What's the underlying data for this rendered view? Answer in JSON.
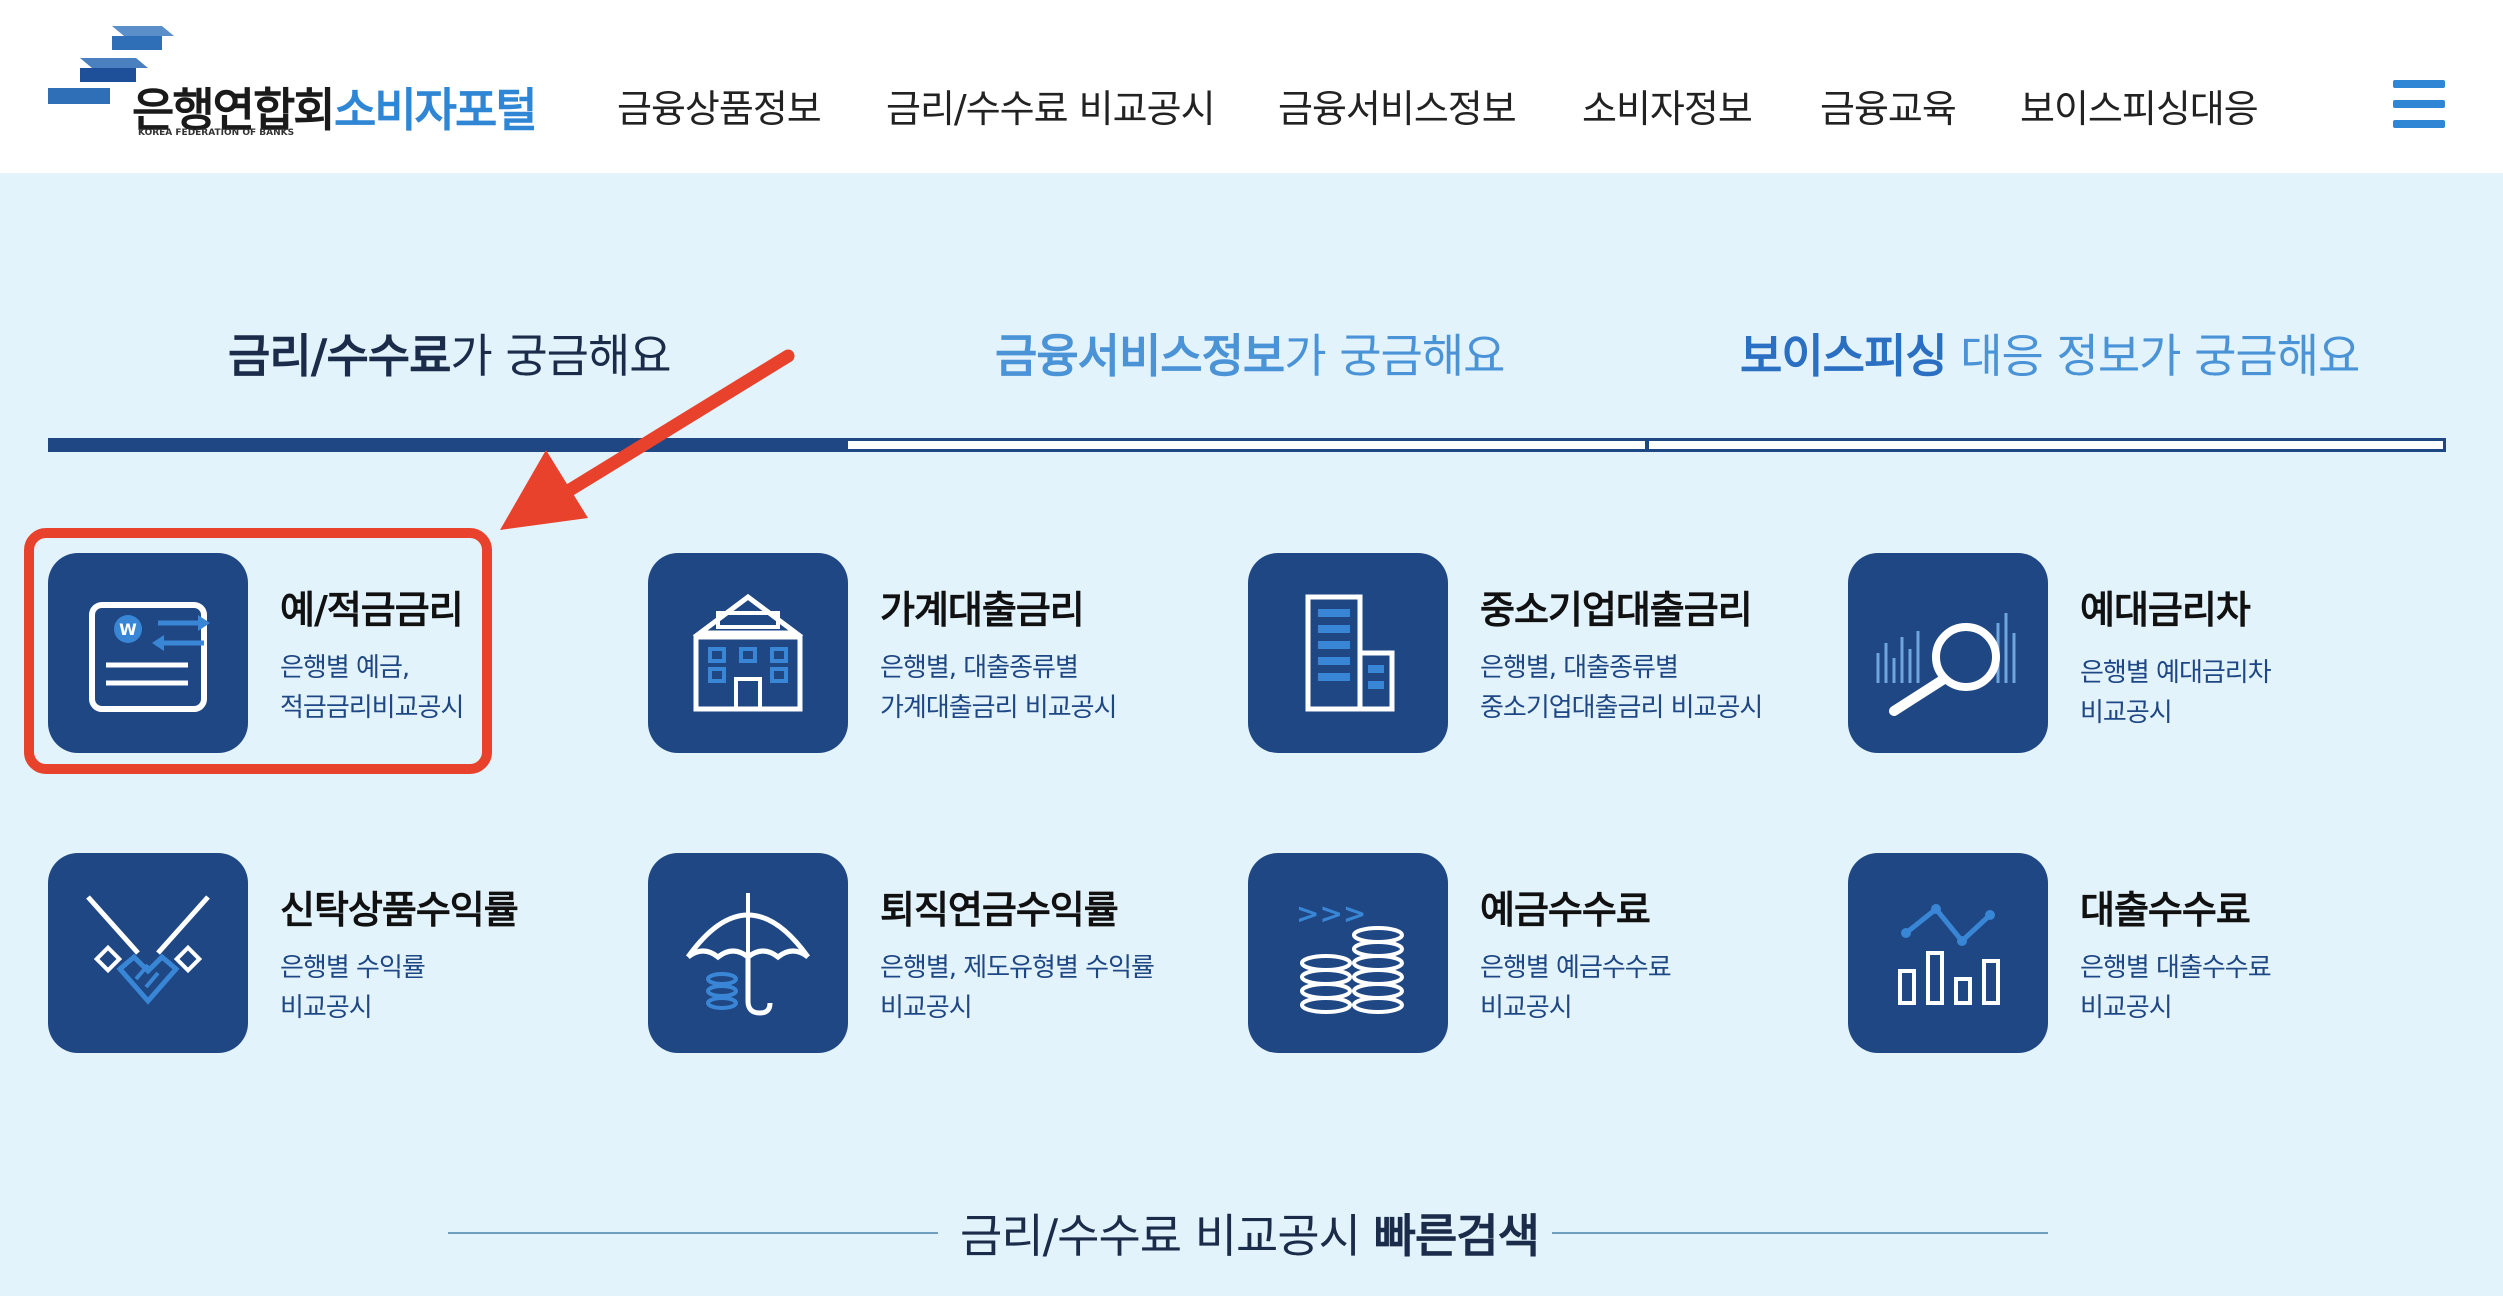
{
  "header": {
    "logo_kr": "은행연합회",
    "logo_en": "KOREA FEDERATION OF BANKS",
    "portal": "소비자포털",
    "nav": [
      "금융상품정보",
      "금리/수수료 비교공시",
      "금융서비스정보",
      "소비자정보",
      "금융교육",
      "보이스피싱대응"
    ],
    "menu_icon": "hamburger-menu-icon"
  },
  "tabs": [
    {
      "strong": "금리/수수료",
      "rest": "가 궁금해요",
      "active": true
    },
    {
      "strong": "금융서비스정보",
      "rest": "가 궁금해요",
      "active": false
    },
    {
      "strong": "보이스피싱",
      "rest": " 대응 정보가 궁금해요",
      "active": false
    }
  ],
  "cards": [
    {
      "title": "예/적금금리",
      "desc1": "은행별 예금,",
      "desc2": "적금금리비교공시",
      "icon": "bankbook-transfer-icon"
    },
    {
      "title": "가계대출금리",
      "desc1": "은행별, 대출종류별",
      "desc2": "가계대출금리 비교공시",
      "icon": "house-icon"
    },
    {
      "title": "중소기업대출금리",
      "desc1": "은행별, 대출종류별",
      "desc2": "중소기업대출금리 비교공시",
      "icon": "building-icon"
    },
    {
      "title": "예대금리차",
      "desc1": "은행별 예대금리차",
      "desc2": "비교공시",
      "icon": "magnifier-chart-icon"
    },
    {
      "title": "신탁상품수익률",
      "desc1": "은행별 수익률",
      "desc2": "비교공시",
      "icon": "handshake-icon"
    },
    {
      "title": "퇴직연금수익률",
      "desc1": "은행별, 제도유형별 수익률",
      "desc2": "비교공시",
      "icon": "umbrella-icon"
    },
    {
      "title": "예금수수료",
      "desc1": "은행별 예금수수료",
      "desc2": "비교공시",
      "icon": "coin-stack-icon"
    },
    {
      "title": "대출수수료",
      "desc1": "은행별 대출수수료",
      "desc2": "비교공시",
      "icon": "bar-line-chart-icon"
    }
  ],
  "quick_search": {
    "prefix": "금리/수수료 비교공시 ",
    "strong": "빠른검색"
  },
  "colors": {
    "navy": "#1e4783",
    "accent_blue": "#2f86d4",
    "background": "#e3f3fc",
    "highlight_red": "#e8412c"
  }
}
